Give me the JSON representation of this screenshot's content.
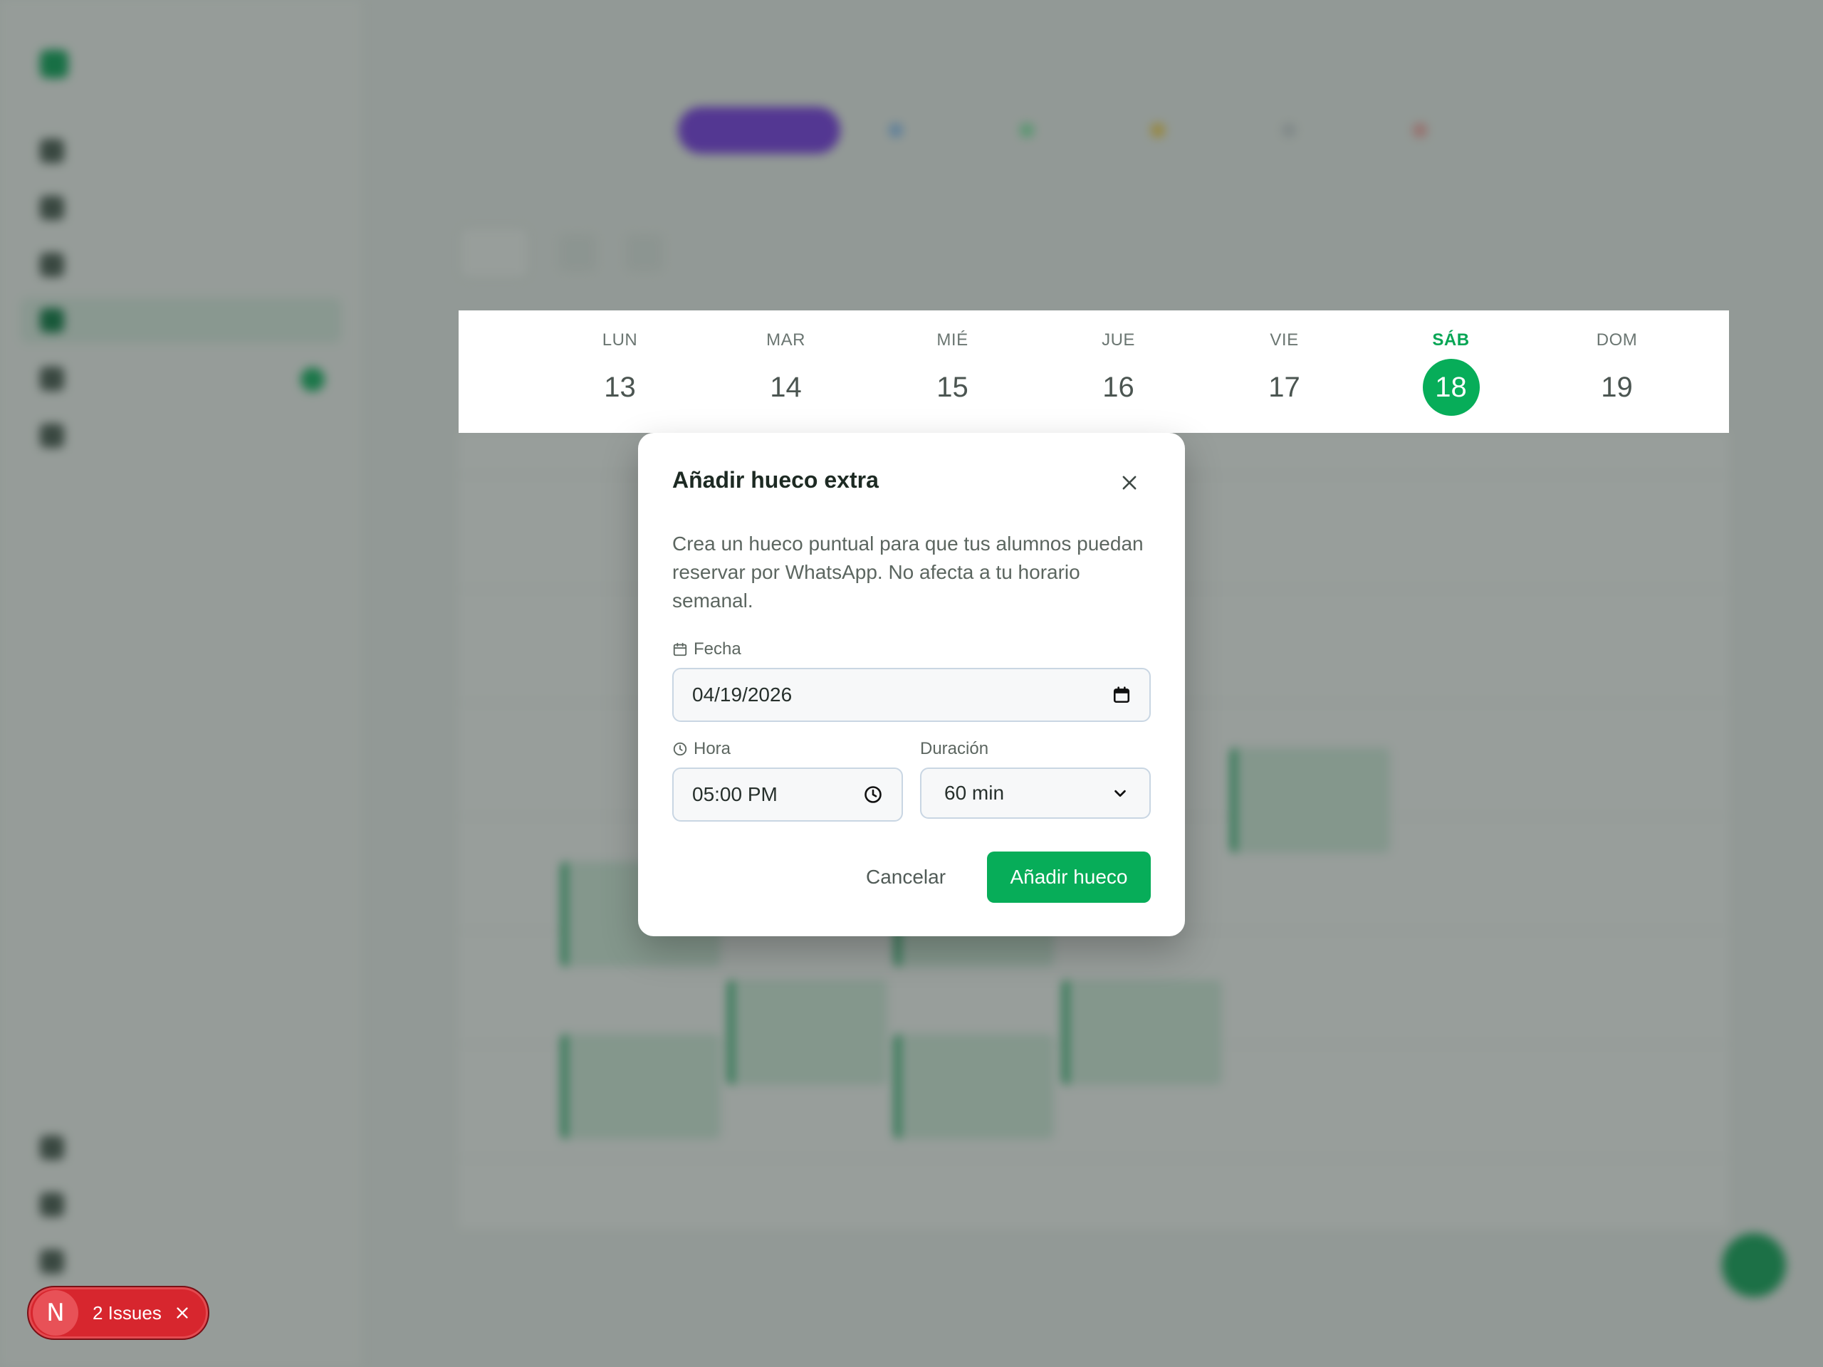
{
  "week": {
    "days": [
      {
        "name": "LUN",
        "number": "13"
      },
      {
        "name": "MAR",
        "number": "14"
      },
      {
        "name": "MIÉ",
        "number": "15"
      },
      {
        "name": "JUE",
        "number": "16"
      },
      {
        "name": "VIE",
        "number": "17"
      },
      {
        "name": "SÁB",
        "number": "18",
        "today": true
      },
      {
        "name": "DOM",
        "number": "19"
      }
    ]
  },
  "modal": {
    "title": "Añadir hueco extra",
    "description": "Crea un hueco puntual para que tus alumnos puedan reservar por WhatsApp. No afecta a tu horario semanal.",
    "date_label": "Fecha",
    "date_value": "04/19/2026",
    "time_label": "Hora",
    "time_value": "05:00 PM",
    "duration_label": "Duración",
    "duration_value": "60 min",
    "cancel_label": "Cancelar",
    "submit_label": "Añadir hueco",
    "close_icon": "close-icon"
  },
  "issues": {
    "badge": "N",
    "label": "2 Issues"
  },
  "colors": {
    "accent_green": "#07ad59",
    "issues_red": "#d7262e",
    "filter_purple": "#7c3aed"
  }
}
